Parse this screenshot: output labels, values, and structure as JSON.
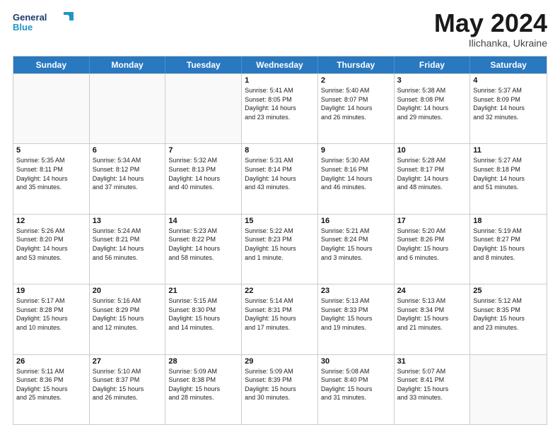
{
  "header": {
    "logo_line1": "General",
    "logo_line2": "Blue",
    "month": "May 2024",
    "location": "Ilichanka, Ukraine"
  },
  "days_of_week": [
    "Sunday",
    "Monday",
    "Tuesday",
    "Wednesday",
    "Thursday",
    "Friday",
    "Saturday"
  ],
  "rows": [
    [
      {
        "num": "",
        "info": ""
      },
      {
        "num": "",
        "info": ""
      },
      {
        "num": "",
        "info": ""
      },
      {
        "num": "1",
        "info": "Sunrise: 5:41 AM\nSunset: 8:05 PM\nDaylight: 14 hours\nand 23 minutes."
      },
      {
        "num": "2",
        "info": "Sunrise: 5:40 AM\nSunset: 8:07 PM\nDaylight: 14 hours\nand 26 minutes."
      },
      {
        "num": "3",
        "info": "Sunrise: 5:38 AM\nSunset: 8:08 PM\nDaylight: 14 hours\nand 29 minutes."
      },
      {
        "num": "4",
        "info": "Sunrise: 5:37 AM\nSunset: 8:09 PM\nDaylight: 14 hours\nand 32 minutes."
      }
    ],
    [
      {
        "num": "5",
        "info": "Sunrise: 5:35 AM\nSunset: 8:11 PM\nDaylight: 14 hours\nand 35 minutes."
      },
      {
        "num": "6",
        "info": "Sunrise: 5:34 AM\nSunset: 8:12 PM\nDaylight: 14 hours\nand 37 minutes."
      },
      {
        "num": "7",
        "info": "Sunrise: 5:32 AM\nSunset: 8:13 PM\nDaylight: 14 hours\nand 40 minutes."
      },
      {
        "num": "8",
        "info": "Sunrise: 5:31 AM\nSunset: 8:14 PM\nDaylight: 14 hours\nand 43 minutes."
      },
      {
        "num": "9",
        "info": "Sunrise: 5:30 AM\nSunset: 8:16 PM\nDaylight: 14 hours\nand 46 minutes."
      },
      {
        "num": "10",
        "info": "Sunrise: 5:28 AM\nSunset: 8:17 PM\nDaylight: 14 hours\nand 48 minutes."
      },
      {
        "num": "11",
        "info": "Sunrise: 5:27 AM\nSunset: 8:18 PM\nDaylight: 14 hours\nand 51 minutes."
      }
    ],
    [
      {
        "num": "12",
        "info": "Sunrise: 5:26 AM\nSunset: 8:20 PM\nDaylight: 14 hours\nand 53 minutes."
      },
      {
        "num": "13",
        "info": "Sunrise: 5:24 AM\nSunset: 8:21 PM\nDaylight: 14 hours\nand 56 minutes."
      },
      {
        "num": "14",
        "info": "Sunrise: 5:23 AM\nSunset: 8:22 PM\nDaylight: 14 hours\nand 58 minutes."
      },
      {
        "num": "15",
        "info": "Sunrise: 5:22 AM\nSunset: 8:23 PM\nDaylight: 15 hours\nand 1 minute."
      },
      {
        "num": "16",
        "info": "Sunrise: 5:21 AM\nSunset: 8:24 PM\nDaylight: 15 hours\nand 3 minutes."
      },
      {
        "num": "17",
        "info": "Sunrise: 5:20 AM\nSunset: 8:26 PM\nDaylight: 15 hours\nand 6 minutes."
      },
      {
        "num": "18",
        "info": "Sunrise: 5:19 AM\nSunset: 8:27 PM\nDaylight: 15 hours\nand 8 minutes."
      }
    ],
    [
      {
        "num": "19",
        "info": "Sunrise: 5:17 AM\nSunset: 8:28 PM\nDaylight: 15 hours\nand 10 minutes."
      },
      {
        "num": "20",
        "info": "Sunrise: 5:16 AM\nSunset: 8:29 PM\nDaylight: 15 hours\nand 12 minutes."
      },
      {
        "num": "21",
        "info": "Sunrise: 5:15 AM\nSunset: 8:30 PM\nDaylight: 15 hours\nand 14 minutes."
      },
      {
        "num": "22",
        "info": "Sunrise: 5:14 AM\nSunset: 8:31 PM\nDaylight: 15 hours\nand 17 minutes."
      },
      {
        "num": "23",
        "info": "Sunrise: 5:13 AM\nSunset: 8:33 PM\nDaylight: 15 hours\nand 19 minutes."
      },
      {
        "num": "24",
        "info": "Sunrise: 5:13 AM\nSunset: 8:34 PM\nDaylight: 15 hours\nand 21 minutes."
      },
      {
        "num": "25",
        "info": "Sunrise: 5:12 AM\nSunset: 8:35 PM\nDaylight: 15 hours\nand 23 minutes."
      }
    ],
    [
      {
        "num": "26",
        "info": "Sunrise: 5:11 AM\nSunset: 8:36 PM\nDaylight: 15 hours\nand 25 minutes."
      },
      {
        "num": "27",
        "info": "Sunrise: 5:10 AM\nSunset: 8:37 PM\nDaylight: 15 hours\nand 26 minutes."
      },
      {
        "num": "28",
        "info": "Sunrise: 5:09 AM\nSunset: 8:38 PM\nDaylight: 15 hours\nand 28 minutes."
      },
      {
        "num": "29",
        "info": "Sunrise: 5:09 AM\nSunset: 8:39 PM\nDaylight: 15 hours\nand 30 minutes."
      },
      {
        "num": "30",
        "info": "Sunrise: 5:08 AM\nSunset: 8:40 PM\nDaylight: 15 hours\nand 31 minutes."
      },
      {
        "num": "31",
        "info": "Sunrise: 5:07 AM\nSunset: 8:41 PM\nDaylight: 15 hours\nand 33 minutes."
      },
      {
        "num": "",
        "info": ""
      }
    ]
  ]
}
